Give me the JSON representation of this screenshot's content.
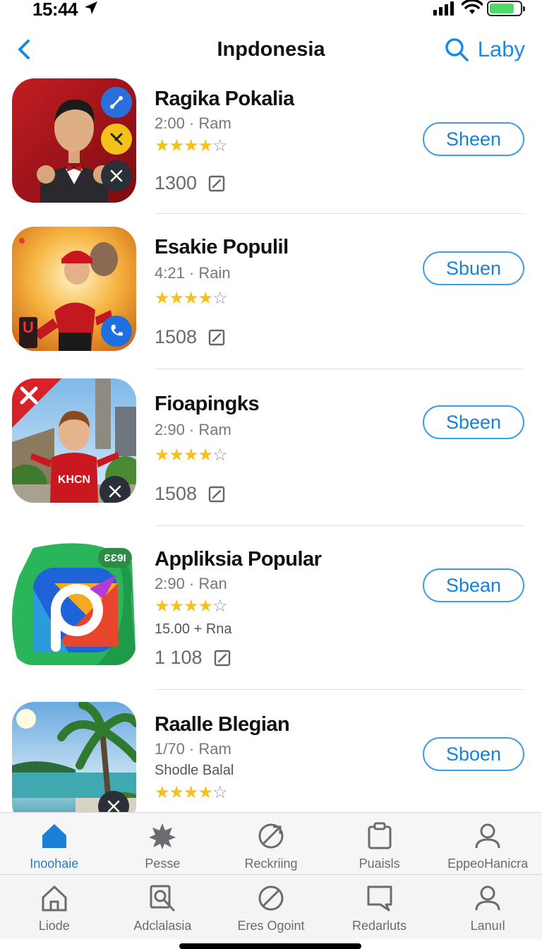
{
  "status_bar": {
    "time": "15:44",
    "icons": [
      "location-arrow-icon",
      "signal-icon",
      "wifi-icon",
      "battery-icon"
    ]
  },
  "nav": {
    "title": "Inpdonesia",
    "search_label": "Laby",
    "back_icon": "chevron-left-icon",
    "search_icon": "search-icon"
  },
  "apps": [
    {
      "name": "Ragika Pokalia",
      "meta": "2:00 · Ram",
      "rating": 4,
      "count": "1300",
      "button": "Sheen"
    },
    {
      "name": "Esakie Populil",
      "meta": "4:21 · Rain",
      "rating": 4,
      "count": "1508",
      "button": "Sbuen"
    },
    {
      "name": "Fioapingks",
      "meta": "2:90 · Ram",
      "rating": 4,
      "count": "1508",
      "button": "Sbeen"
    },
    {
      "name": "Appliksia Popular",
      "meta": "2:90 · Ran",
      "extra": "15.00 + Rna",
      "badge": "ƐƐ9Ɩ",
      "rating": 4,
      "count": "1 108",
      "button": "Sbean"
    },
    {
      "name": "Raalle Blegian",
      "meta": "1/70 · Ram",
      "extra": "Shodle Balal",
      "rating": 4,
      "button": "Sboen"
    }
  ],
  "tab_bar_primary": [
    {
      "label": "Inoohaie",
      "icon": "home-icon",
      "active": true
    },
    {
      "label": "Pesse",
      "icon": "star-burst-icon"
    },
    {
      "label": "Reckriing",
      "icon": "compass-icon"
    },
    {
      "label": "Puaisls",
      "icon": "clipboard-icon"
    },
    {
      "label": "EppeoHanicra",
      "icon": "person-icon"
    }
  ],
  "tab_bar_secondary": [
    {
      "label": "Liode",
      "icon": "home-outline-icon"
    },
    {
      "label": "Adclalasia",
      "icon": "search-doc-icon"
    },
    {
      "label": "Eres Ogoint",
      "icon": "prohibited-icon"
    },
    {
      "label": "Redarluts",
      "icon": "chat-square-icon"
    },
    {
      "label": "Lanuıl",
      "icon": "person-outline-icon"
    }
  ],
  "colors": {
    "accent": "#1a7fd6",
    "star": "#f5c020",
    "active_tab": "#1a7fd6"
  }
}
